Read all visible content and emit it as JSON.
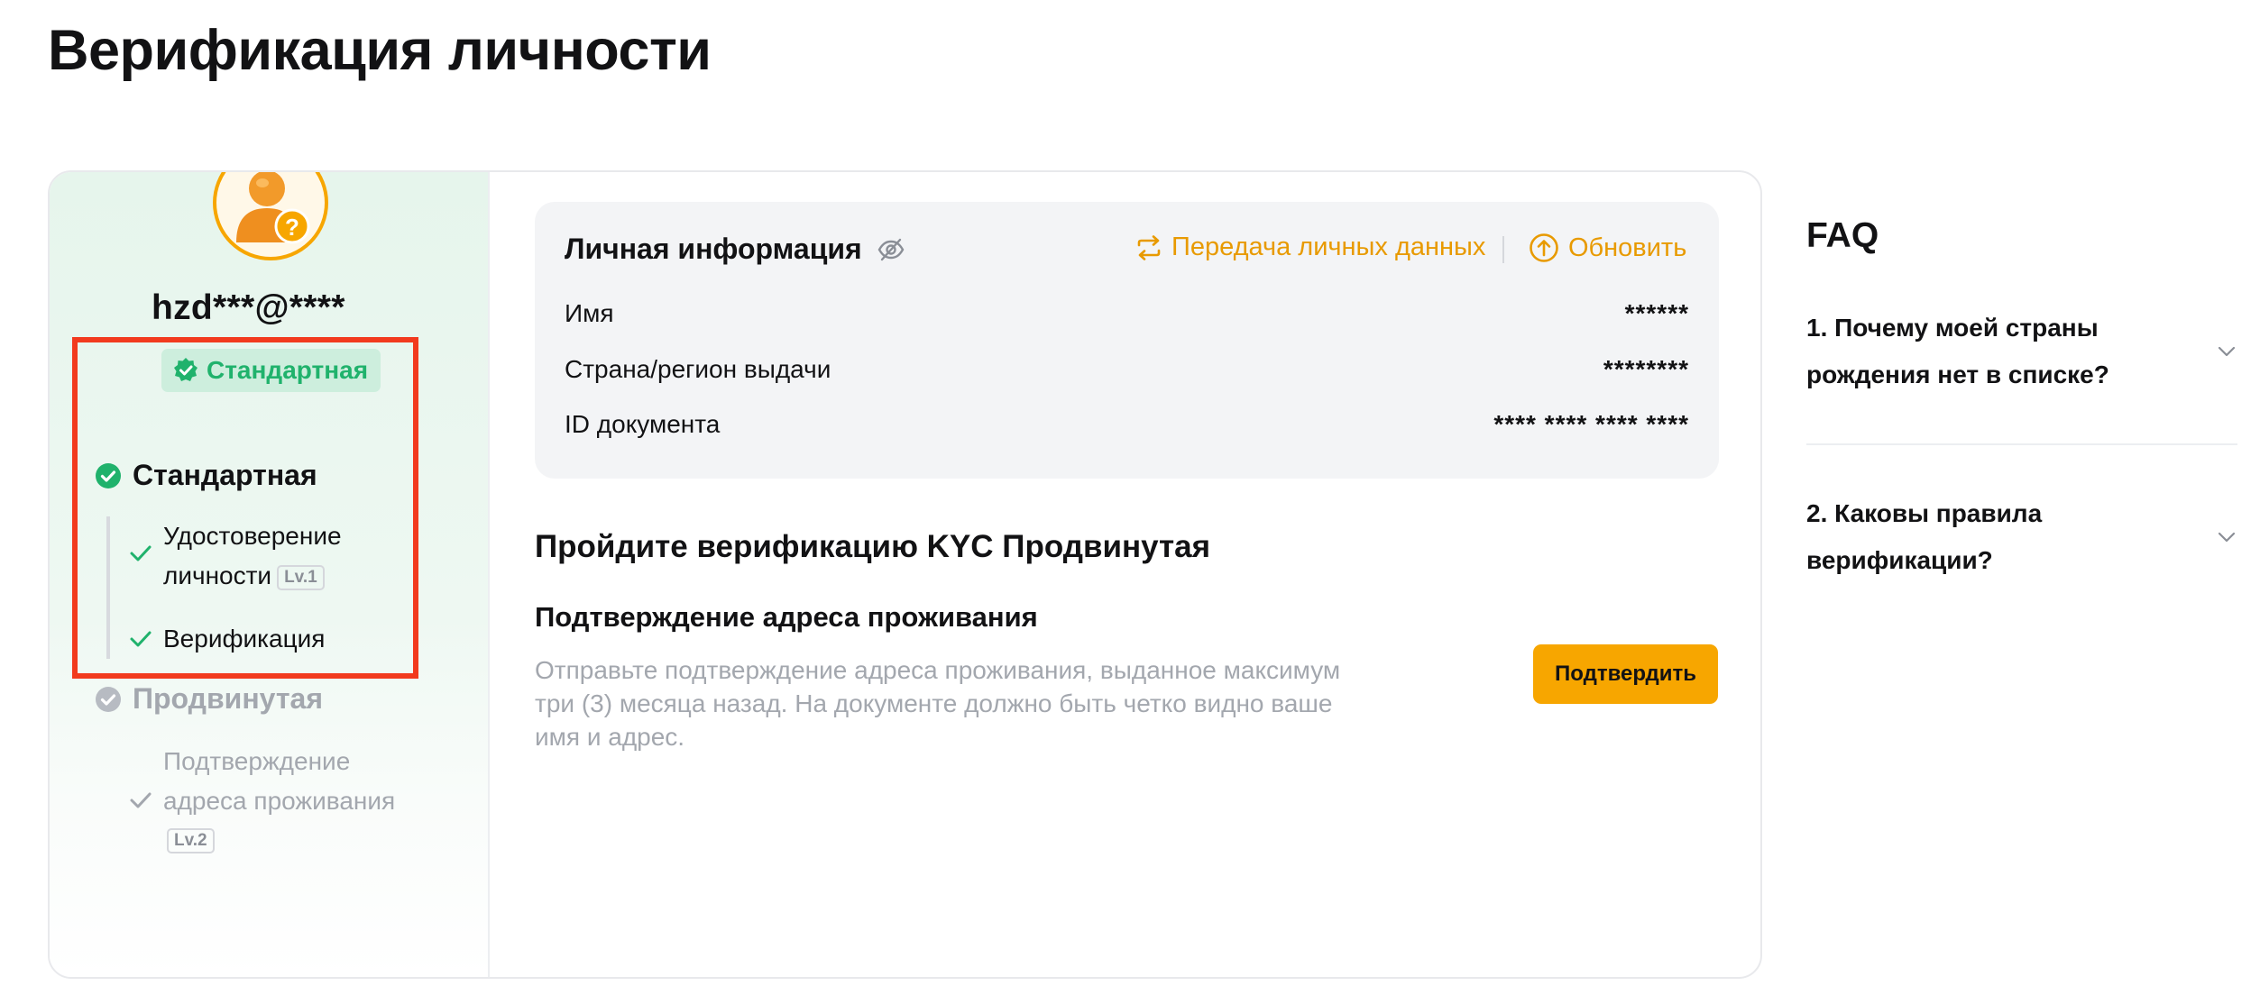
{
  "page": {
    "title": "Верификация личности"
  },
  "profile": {
    "username": "hzd***@****",
    "badge": "Стандартная"
  },
  "levels": {
    "standard": {
      "label": "Стандартная",
      "steps": [
        {
          "line1": "Удостоверение",
          "line2": "личности",
          "tag": "Lv.1"
        },
        {
          "line1": "Верификация"
        }
      ]
    },
    "advanced": {
      "label": "Продвинутая",
      "steps": [
        {
          "line1": "Подтверждение",
          "line2": "адреса проживания",
          "tag": "Lv.2"
        }
      ]
    }
  },
  "personal_info": {
    "title": "Личная информация",
    "transfer_link": "Передача личных данных",
    "update_link": "Обновить",
    "rows": [
      {
        "label": "Имя",
        "value": "******"
      },
      {
        "label": "Страна/регион выдачи",
        "value": "********"
      },
      {
        "label": "ID документа",
        "value": "**** **** **** ****"
      }
    ]
  },
  "kyc": {
    "title": "Пройдите верификацию KYC Продвинутая",
    "address_title": "Подтверждение адреса проживания",
    "address_desc": "Отправьте подтверждение адреса проживания, выданное максимум три (3) месяца назад. На документе должно быть четко видно ваше имя и адрес.",
    "confirm_button": "Подтвердить"
  },
  "faq": {
    "title": "FAQ",
    "items": [
      {
        "question": "1. Почему моей страны рождения нет в списке?"
      },
      {
        "question": "2. Каковы правила верификации?"
      }
    ]
  },
  "colors": {
    "accent": "#f7a600",
    "link": "#e89a00",
    "success": "#20b26c",
    "highlight": "#f23a1e",
    "muted": "#a3a7ae"
  }
}
